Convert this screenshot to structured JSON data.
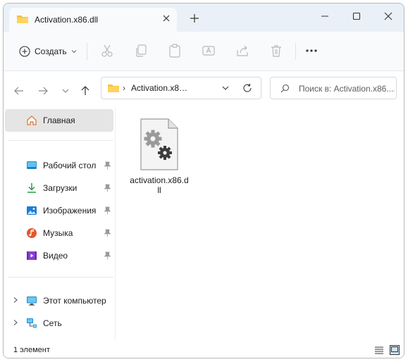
{
  "window": {
    "tab_title": "Activation.x86.dll",
    "controls": {
      "minimize": "minimize",
      "maximize": "maximize",
      "close": "close"
    }
  },
  "toolbar": {
    "create_label": "Создать",
    "icons": [
      "cut-icon",
      "copy-icon",
      "paste-icon",
      "rename-icon",
      "share-icon",
      "delete-icon",
      "more-icon"
    ]
  },
  "address": {
    "path_label": "Activation.x8…",
    "search_placeholder": "Поиск в: Activation.x86...."
  },
  "sidebar": {
    "home": {
      "label": "Главная"
    },
    "items": [
      {
        "label": "Рабочий стол",
        "icon": "desktop-icon",
        "pinned": true
      },
      {
        "label": "Загрузки",
        "icon": "downloads-icon",
        "pinned": true
      },
      {
        "label": "Изображения",
        "icon": "pictures-icon",
        "pinned": true
      },
      {
        "label": "Музыка",
        "icon": "music-icon",
        "pinned": true
      },
      {
        "label": "Видео",
        "icon": "videos-icon",
        "pinned": true
      }
    ],
    "tree": [
      {
        "label": "Этот компьютер",
        "icon": "this-pc-icon"
      },
      {
        "label": "Сеть",
        "icon": "network-icon"
      }
    ]
  },
  "content": {
    "files": [
      {
        "name": "activation.x86.dll",
        "icon": "dll-file-icon"
      }
    ]
  },
  "status": {
    "count_text": "1 элемент"
  },
  "colors": {
    "accent": "#0067c0",
    "folder": "#f5c242",
    "titlebar": "#eaf0f7"
  }
}
